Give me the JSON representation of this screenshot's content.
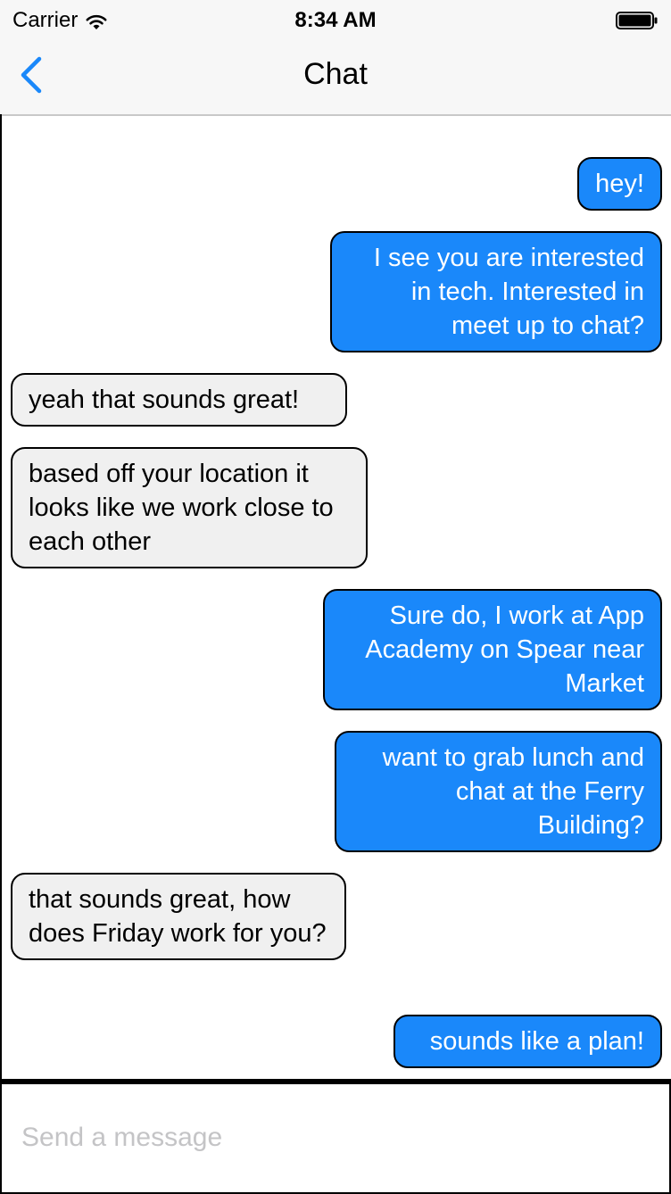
{
  "status_bar": {
    "carrier": "Carrier",
    "time": "8:34 AM"
  },
  "nav": {
    "title": "Chat",
    "back_icon": "chevron-left-icon"
  },
  "messages": [
    {
      "direction": "out",
      "text": "hey!"
    },
    {
      "direction": "out",
      "text": "I see you are interested in tech. Interested in meet up to chat?"
    },
    {
      "direction": "in",
      "text": "yeah that sounds great!"
    },
    {
      "direction": "in",
      "text": "based off your location it looks like we work close to each other"
    },
    {
      "direction": "out",
      "text": "Sure do, I work at App Academy on Spear near Market"
    },
    {
      "direction": "out",
      "text": "want to grab lunch and chat at the Ferry Building?"
    },
    {
      "direction": "in",
      "text": "that sounds great, how does Friday work for you?"
    },
    {
      "direction": "out",
      "text": "sounds like a plan!"
    }
  ],
  "composer": {
    "value": "",
    "placeholder": "Send a message"
  },
  "colors": {
    "outgoing_bubble": "#1a88fa",
    "incoming_bubble": "#f0f0f0",
    "accent": "#1a88fa"
  }
}
